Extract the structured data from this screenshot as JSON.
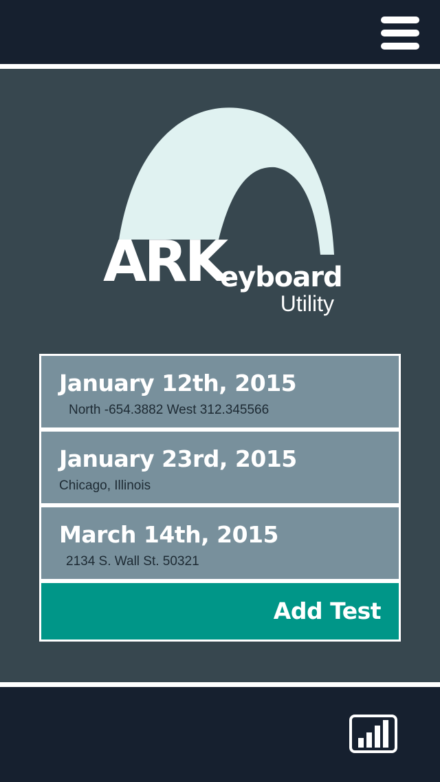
{
  "header": {
    "menu_icon": "hamburger-menu-icon"
  },
  "logo": {
    "ark": "ARK",
    "eyboard": "eyboard",
    "utility": "Utility",
    "arch_color": "#e0f2f1"
  },
  "tests": [
    {
      "date": "January 12th, 2015",
      "location": "North -654.3882 West 312.345566"
    },
    {
      "date": "January 23rd, 2015",
      "location": "Chicago, Illinois"
    },
    {
      "date": "March 14th, 2015",
      "location": "2134 S. Wall St. 50321"
    }
  ],
  "add_test": {
    "label": "Add Test"
  },
  "footer": {
    "chart_icon": "bar-chart-icon"
  },
  "colors": {
    "bar_background": "#16202f",
    "main_background": "#37474f",
    "list_item": "#78909c",
    "accent": "#009688"
  }
}
